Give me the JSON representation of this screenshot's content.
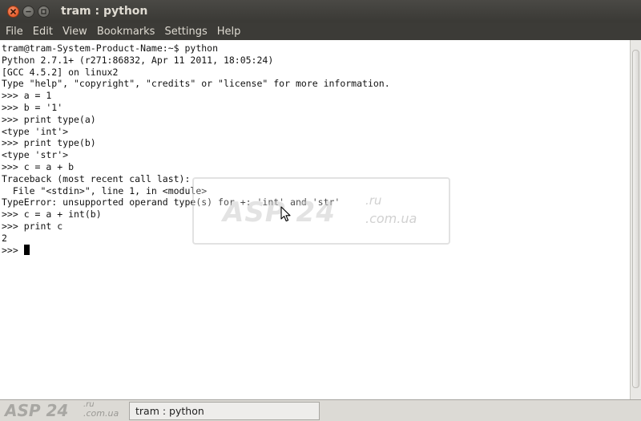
{
  "window": {
    "title": "tram : python",
    "controls": [
      "close-icon",
      "minimize-icon",
      "maximize-icon"
    ]
  },
  "menu": [
    "File",
    "Edit",
    "View",
    "Bookmarks",
    "Settings",
    "Help"
  ],
  "terminal": {
    "lines": [
      "tram@tram-System-Product-Name:~$ python",
      "Python 2.7.1+ (r271:86832, Apr 11 2011, 18:05:24)",
      "[GCC 4.5.2] on linux2",
      "Type \"help\", \"copyright\", \"credits\" or \"license\" for more information.",
      ">>> a = 1",
      ">>> b = '1'",
      ">>> print type(a)",
      "<type 'int'>",
      ">>> print type(b)",
      "<type 'str'>",
      ">>> c = a + b",
      "Traceback (most recent call last):",
      "  File \"<stdin>\", line 1, in <module>",
      "TypeError: unsupported operand type(s) for +: 'int' and 'str'",
      ">>> c = a + int(b)",
      ">>> print c",
      "2"
    ],
    "prompt": ">>> "
  },
  "watermark": {
    "main": "ASP 24",
    "suffix": ".ru",
    "sub": ".com.ua"
  },
  "taskbar": {
    "task_label": "tram : python"
  },
  "colors": {
    "close_button": "#df4a16",
    "titlebar": "#3c3b37",
    "terminal_bg": "#ffffff",
    "terminal_fg": "#111111"
  }
}
